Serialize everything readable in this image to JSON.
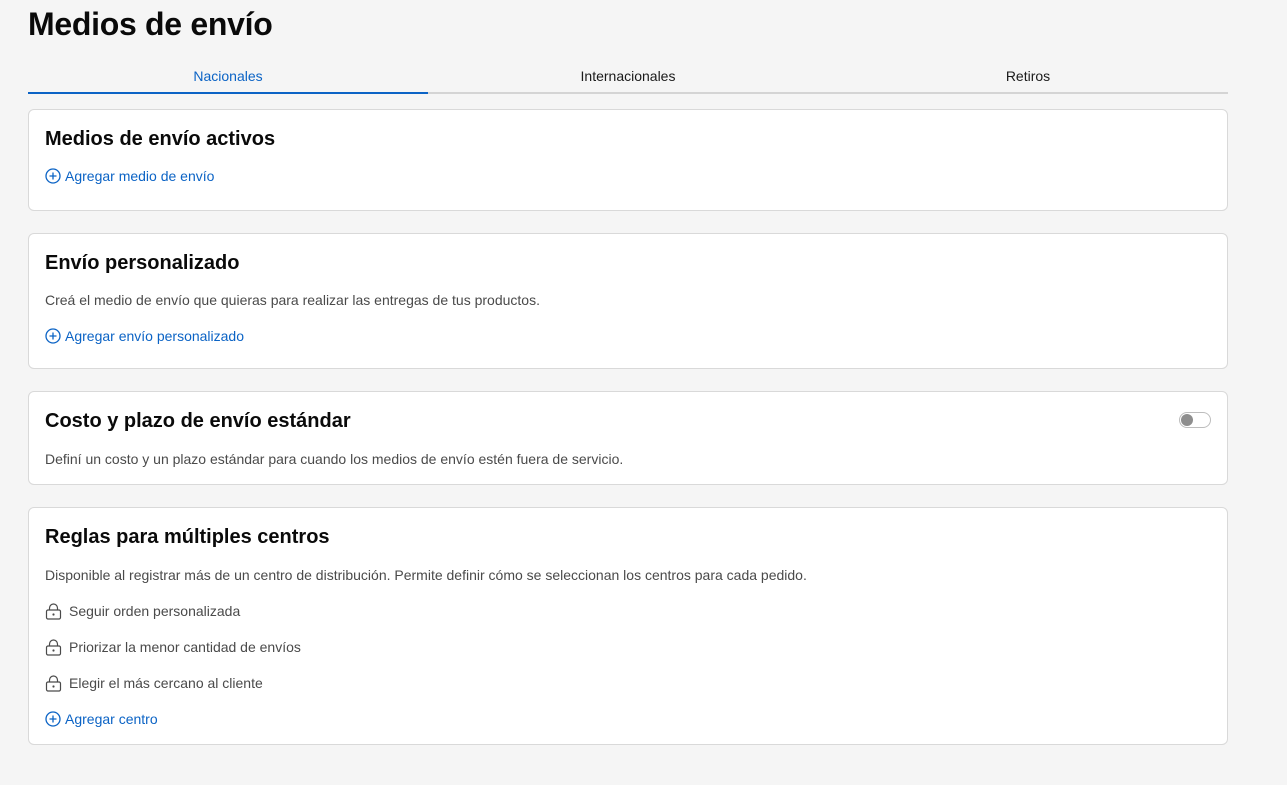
{
  "page_title": "Medios de envío",
  "tabs": [
    {
      "label": "Nacionales",
      "active": true
    },
    {
      "label": "Internacionales",
      "active": false
    },
    {
      "label": "Retiros",
      "active": false
    }
  ],
  "cards": {
    "active_methods": {
      "title": "Medios de envío activos",
      "action": "Agregar medio de envío"
    },
    "custom_shipping": {
      "title": "Envío personalizado",
      "description": "Creá el medio de envío que quieras para realizar las entregas de tus productos.",
      "action": "Agregar envío personalizado"
    },
    "standard_cost": {
      "title": "Costo y plazo de envío estándar",
      "description": "Definí un costo y un plazo estándar para cuando los medios de envío estén fuera de servicio.",
      "toggle_on": false
    },
    "multi_center_rules": {
      "title": "Reglas para múltiples centros",
      "description": "Disponible al registrar más de un centro de distribución. Permite definir cómo se seleccionan los centros para cada pedido.",
      "rules": [
        {
          "label": "Seguir orden personalizada",
          "icon": "lock-icon"
        },
        {
          "label": "Priorizar la menor cantidad de envíos",
          "icon": "lock-icon"
        },
        {
          "label": "Elegir el más cercano al cliente",
          "icon": "lock-icon"
        }
      ],
      "action": "Agregar centro"
    }
  },
  "colors": {
    "accent": "#0b63c5",
    "background": "#f5f5f5",
    "card_border": "#d9d9d9",
    "muted_text": "#4a4a4a"
  }
}
